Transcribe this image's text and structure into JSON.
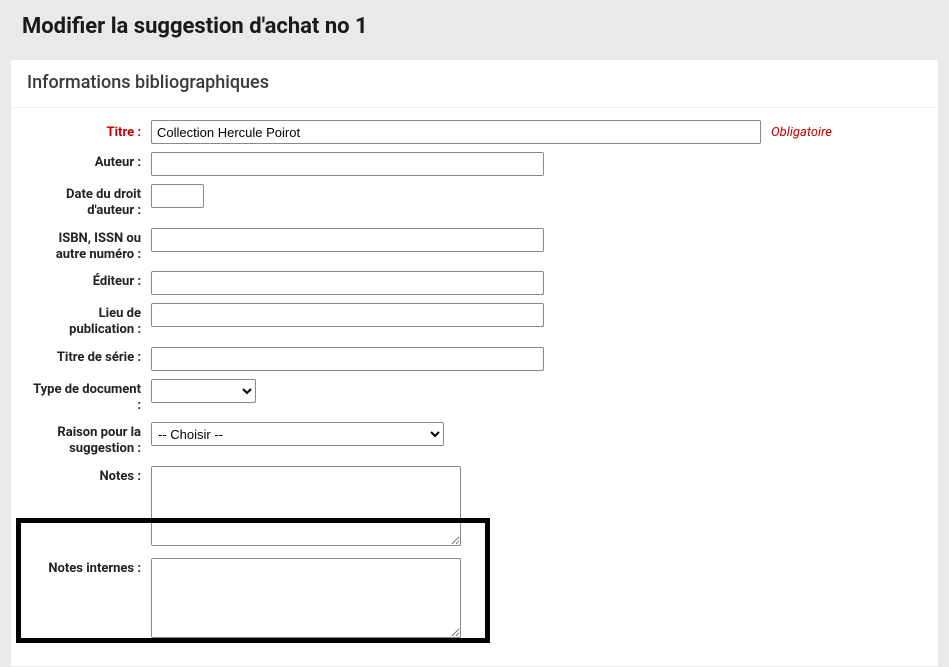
{
  "page": {
    "title": "Modifier la suggestion d'achat no 1"
  },
  "panel": {
    "title": "Informations bibliographiques"
  },
  "fields": {
    "titre": {
      "label": "Titre :",
      "value": "Collection Hercule Poirot",
      "required_hint": "Obligatoire"
    },
    "auteur": {
      "label": "Auteur :",
      "value": ""
    },
    "copyright": {
      "label": "Date du droit d'auteur :",
      "value": ""
    },
    "isbn": {
      "label": "ISBN, ISSN ou autre numéro :",
      "value": ""
    },
    "editeur": {
      "label": "Éditeur :",
      "value": ""
    },
    "lieu": {
      "label": "Lieu de publication :",
      "value": ""
    },
    "serie": {
      "label": "Titre de série :",
      "value": ""
    },
    "doctype": {
      "label": "Type de document :",
      "selected": ""
    },
    "raison": {
      "label": "Raison pour la suggestion :",
      "selected": "-- Choisir --"
    },
    "notes": {
      "label": "Notes :",
      "value": ""
    },
    "notes_internes": {
      "label": "Notes internes :",
      "value": ""
    }
  }
}
